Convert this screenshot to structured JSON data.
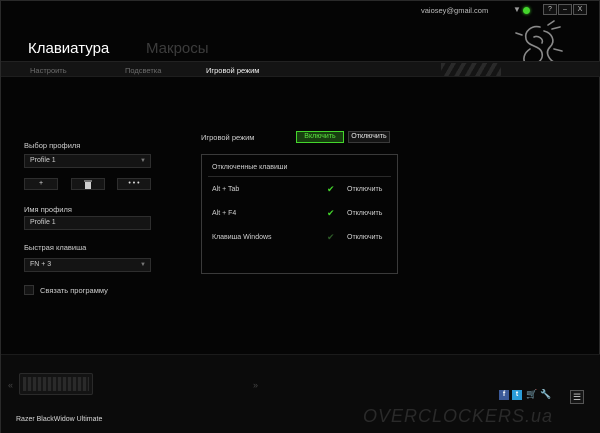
{
  "titlebar": {
    "user_email": "vaiosey@gmail.com",
    "dropdown_symbol": "▼",
    "help_label": "?",
    "minimize_label": "–",
    "close_label": "X"
  },
  "header": {
    "tabs": [
      "Клавиатура",
      "Макросы"
    ],
    "active_tab": "Клавиатура",
    "subnav": [
      "Настроить",
      "Подсветка",
      "Игровой режим"
    ],
    "active_subnav": "Игровой режим"
  },
  "profile": {
    "section_label": "Выбор профиля",
    "selected": "Profile 1",
    "buttons": {
      "add": "+",
      "delete_icon": "trash-icon",
      "more": "• • •"
    },
    "name_label": "Имя профиля",
    "name_value": "Profile 1",
    "hotkey_label": "Быстрая клавиша",
    "hotkey_value": "FN + 3",
    "link_program_label": "Связать программу",
    "link_program_checked": false
  },
  "game_mode": {
    "label": "Игровой режим",
    "on_label": "Включить",
    "off_label": "Отключить",
    "state": "on",
    "disabled_keys_title": "Отключенные клавиши",
    "keys": [
      {
        "name": "Alt + Tab",
        "action": "Отключить",
        "checked": true
      },
      {
        "name": "Alt + F4",
        "action": "Отключить",
        "checked": true
      },
      {
        "name": "Клавиша Windows",
        "action": "Отключить",
        "checked": false
      }
    ]
  },
  "footer": {
    "device_name": "Razer BlackWidow Ultimate",
    "prev_symbol": "«",
    "next_symbol": "»",
    "facebook_label": "f",
    "twitter_label": "t",
    "menu_symbol": "☰",
    "watermark": "OVERCLOCKERS.ua"
  },
  "colors": {
    "accent": "#44d62c",
    "background": "#050505"
  }
}
